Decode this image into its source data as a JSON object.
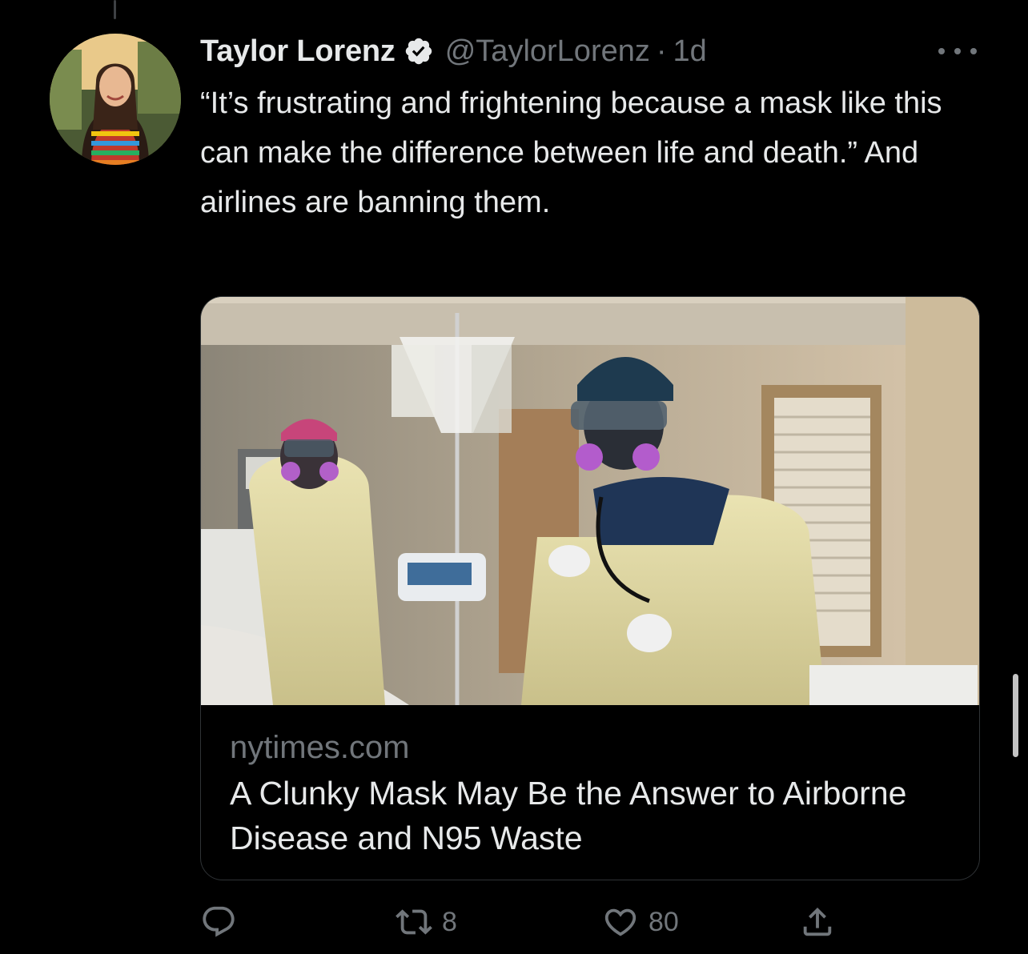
{
  "tweet": {
    "display_name": "Taylor Lorenz",
    "handle": "@TaylorLorenz",
    "separator": "·",
    "time": "1d",
    "text": "“It’s frustrating and frightening because a mask like this can make the difference between life and death.” And airlines are banning them."
  },
  "card": {
    "domain": "nytimes.com",
    "title": "A Clunky Mask May Be the Answer to Airborne Disease and N95 Waste"
  },
  "actions": {
    "reply_count": "",
    "retweet_count": "8",
    "like_count": "80"
  },
  "icons": {
    "verified": "verified-badge-icon",
    "more": "more-options-icon",
    "reply": "reply-icon",
    "retweet": "retweet-icon",
    "like": "heart-icon",
    "share": "share-icon"
  },
  "colors": {
    "background": "#000000",
    "text_primary": "#e7e9ea",
    "text_secondary": "#71767b",
    "border": "#2f3336"
  }
}
